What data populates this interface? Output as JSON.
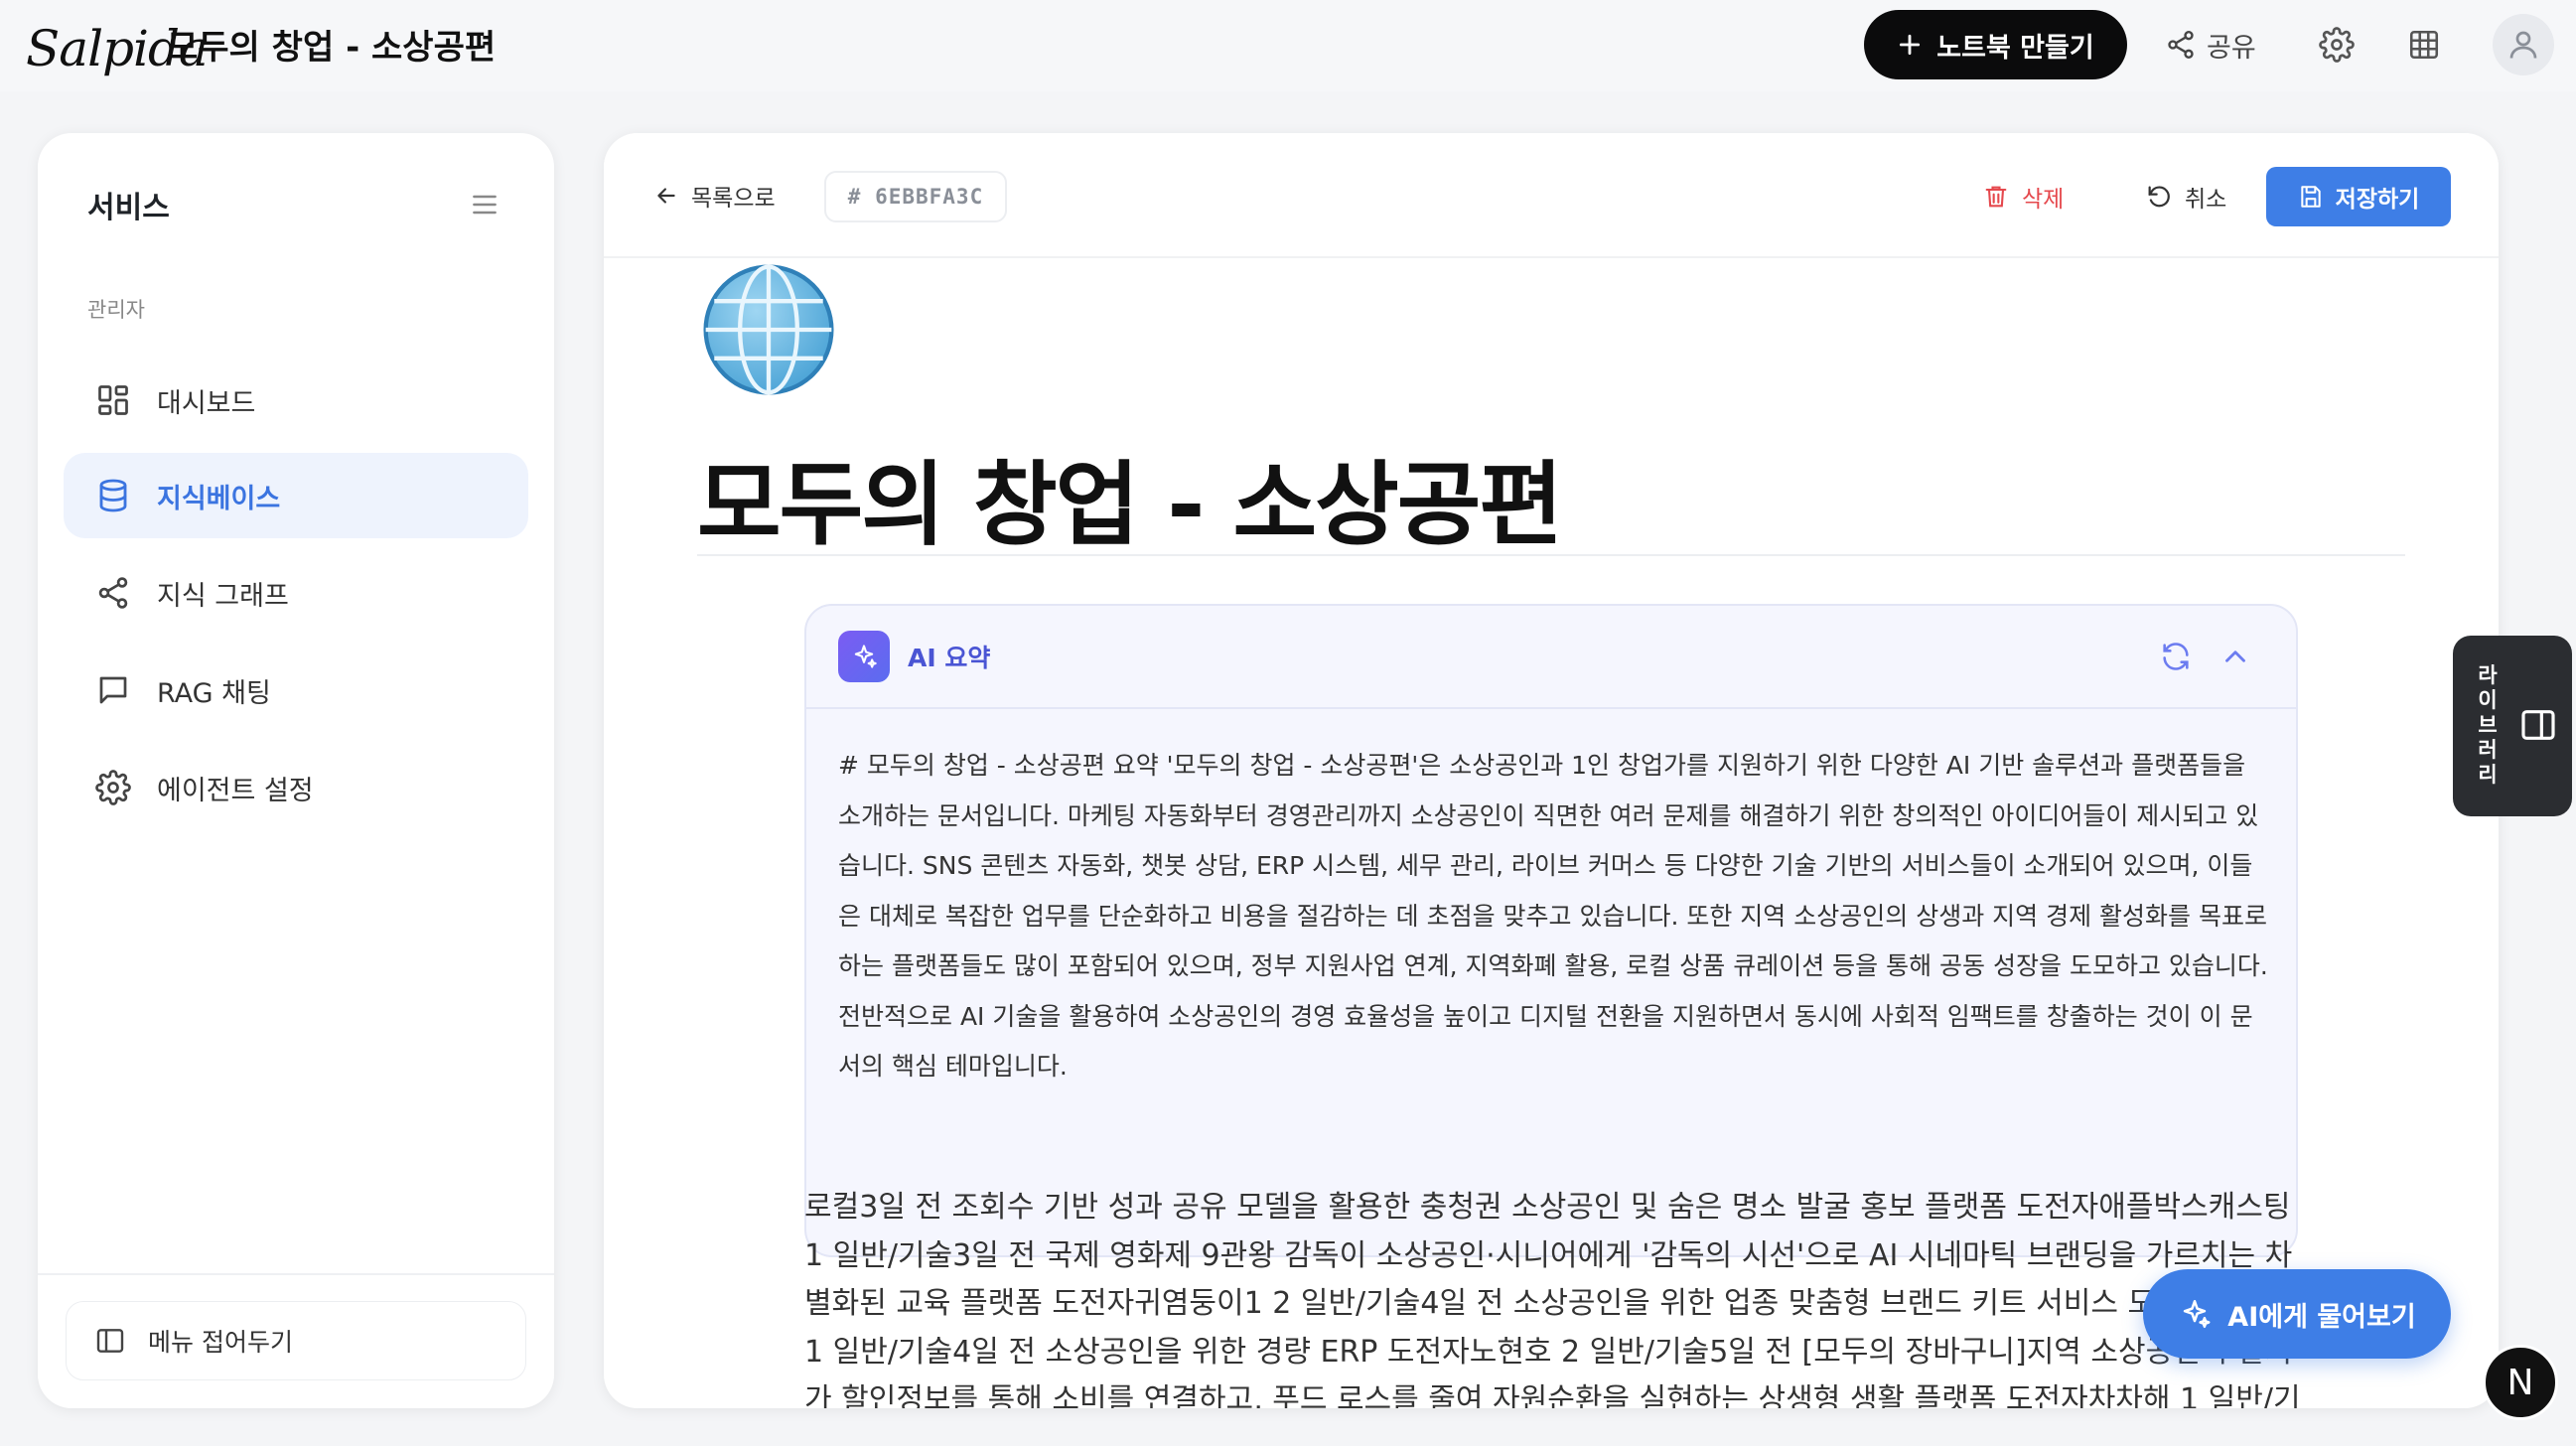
{
  "app": {
    "logo": "Salpida",
    "title": "모두의 창업 - 소상공편"
  },
  "topbar": {
    "notebook_button": "노트북 만들기",
    "share_label": "공유",
    "icons": [
      "plus-icon",
      "share-icon",
      "gear-icon",
      "grid-icon",
      "user-icon"
    ]
  },
  "sidebar": {
    "title": "서비스",
    "section": "관리자",
    "items": [
      {
        "label": "대시보드",
        "icon": "dashboard-icon",
        "active": false
      },
      {
        "label": "지식베이스",
        "icon": "database-icon",
        "active": true
      },
      {
        "label": "지식 그래프",
        "icon": "share-graph-icon",
        "active": false
      },
      {
        "label": "RAG 채팅",
        "icon": "chat-icon",
        "active": false
      },
      {
        "label": "에이전트 설정",
        "icon": "gear-icon",
        "active": false
      }
    ],
    "collapse_label": "메뉴 접어두기"
  },
  "doc_header": {
    "back_label": "목록으로",
    "doc_id": "# 6EBBFA3C",
    "delete_label": "삭제",
    "cancel_label": "취소",
    "save_label": "저장하기"
  },
  "document": {
    "title": "모두의 창업 - 소상공편",
    "ai_summary": {
      "label": "AI 요약",
      "text": "# 모두의 창업 - 소상공편 요약 '모두의 창업 - 소상공편'은 소상공인과 1인 창업가를 지원하기 위한 다양한 AI 기반 솔루션과 플랫폼들을 소개하는 문서입니다. 마케팅 자동화부터 경영관리까지 소상공인이 직면한 여러 문제를 해결하기 위한 창의적인 아이디어들이 제시되고 있습니다. SNS 콘텐츠 자동화, 챗봇 상담, ERP 시스템, 세무 관리, 라이브 커머스 등 다양한 기술 기반의 서비스들이 소개되어 있으며, 이들은 대체로 복잡한 업무를 단순화하고 비용을 절감하는 데 초점을 맞추고 있습니다. 또한 지역 소상공인의 상생과 지역 경제 활성화를 목표로 하는 플랫폼들도 많이 포함되어 있으며, 정부 지원사업 연계, 지역화폐 활용, 로컬 상품 큐레이션 등을 통해 공동 성장을 도모하고 있습니다. 전반적으로 AI 기술을 활용하여 소상공인의 경영 효율성을 높이고 디지털 전환을 지원하면서 동시에 사회적 임팩트를 창출하는 것이 이 문서의 핵심 테마입니다."
    },
    "body_lines": [
      "로컬3일 전 조회수 기반 성과 공유 모델을 활용한 충청권 소상공인 및 숨은 명소 발굴 홍보 플랫폼 도전자애플박스캐스팅",
      "1 일반/기술3일 전 국제 영화제 9관왕 감독이 소상공인·시니어에게 '감독의 시선'으로 AI 시네마틱 브랜딩을 가르치는 차",
      "별화된 교육 플랫폼 도전자귀염둥이1 2 일반/기술4일 전 소상공인을 위한 업종 맞춤형 브랜드 키트 서비스 도",
      "1 일반/기술4일 전 소상공인을 위한 경량 ERP 도전자노현호 2 일반/기술5일 전 [모두의 장바구니]지역 소상공인의 할지",
      "가 할인정보를 통해 소비를 연결하고, 푸드 로스를 줄여 자원순환을 실현하는 상생형 생활 플랫폼 도전자차차해 1 일반/기"
    ]
  },
  "floating": {
    "library_label": "라이브러리",
    "ask_ai_label": "AI에게 물어보기",
    "user_initial": "N"
  },
  "colors": {
    "accent_blue": "#3e7ee6",
    "active_nav_bg": "#eef3fd",
    "delete_red": "#e5484d",
    "ai_purple": "#4a55d4"
  }
}
